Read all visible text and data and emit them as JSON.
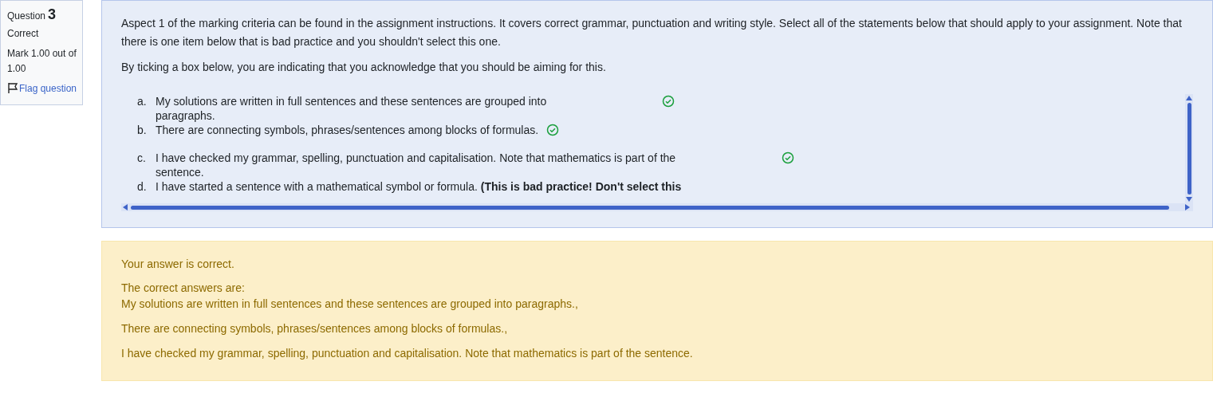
{
  "info": {
    "label": "Question",
    "number": "3",
    "state": "Correct",
    "mark": "Mark 1.00 out of 1.00",
    "flag": {
      "label": "Flag question",
      "flagged": false
    }
  },
  "question": {
    "paragraphs": [
      "Aspect 1 of the marking criteria can be found in the assignment instructions.  It covers correct grammar, punctuation and writing style.  Select all of the statements below that should apply to your assignment.  Note that there is one item below that is bad practice and you shouldn't select this one.",
      "By ticking a box below, you are indicating that you acknowledge that you should be aiming for this."
    ],
    "options": [
      {
        "letter": "a.",
        "text": "My solutions are written in full sentences and these sentences are grouped into paragraphs.",
        "correct": true
      },
      {
        "letter": "b.",
        "text": "There are connecting symbols, phrases/sentences among blocks of formulas.",
        "correct": true
      },
      {
        "letter": "c.",
        "text": "I have checked my grammar, spelling, punctuation and capitalisation. Note that mathematics is part of the sentence.",
        "correct": true
      },
      {
        "letter": "d.",
        "text": "I have started a sentence with a mathematical symbol or formula.  **(This is bad practice! Don't select this**",
        "correct": false
      }
    ]
  },
  "feedback": {
    "result": "Your answer is correct.",
    "heading": "The correct answers are:",
    "answers": [
      "My solutions are written in full sentences and these sentences are grouped into paragraphs.,",
      "There are connecting symbols, phrases/sentences among blocks of formulas.,",
      "I have checked my grammar, spelling, punctuation and capitalisation. Note that mathematics is part of the sentence."
    ]
  }
}
